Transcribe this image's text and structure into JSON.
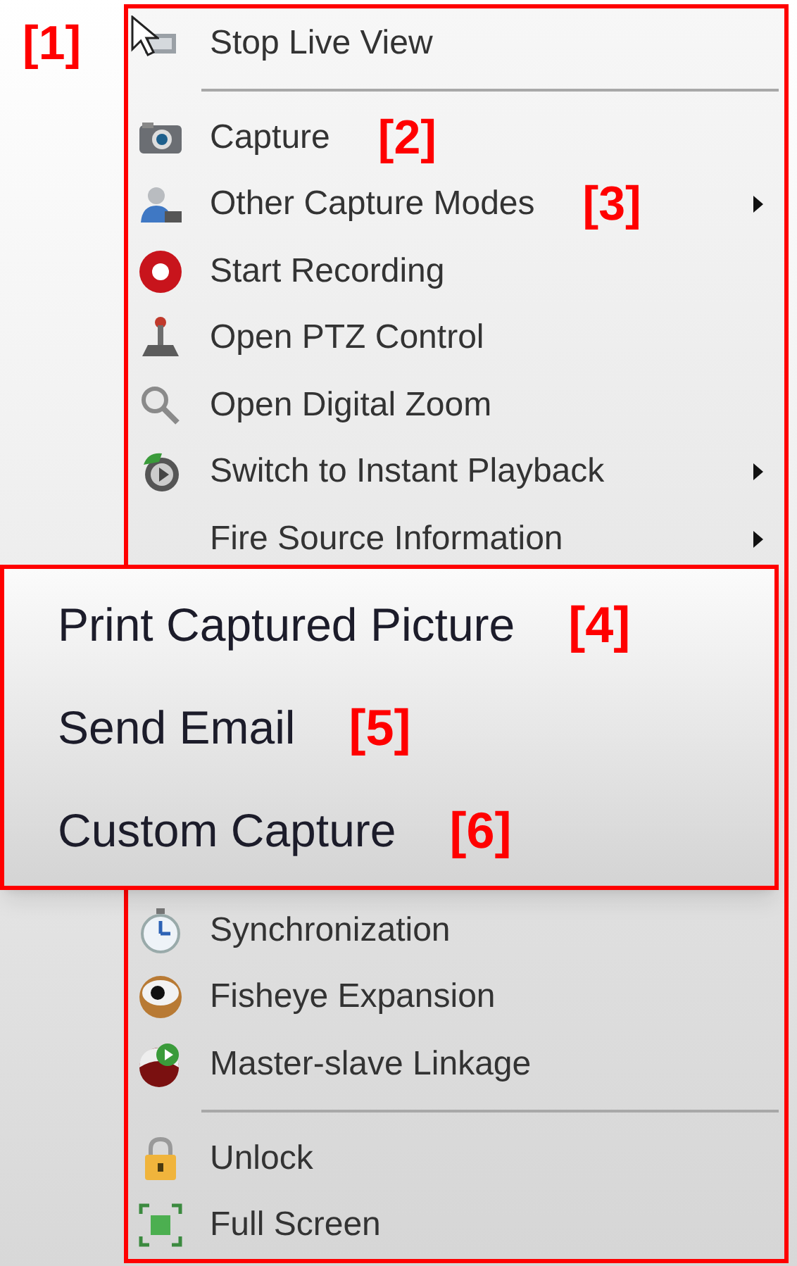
{
  "menu": {
    "annotation": "[1]",
    "items_above": [
      {
        "kind": "item",
        "label": "Stop Live View",
        "submenu": false
      },
      {
        "kind": "separator"
      },
      {
        "kind": "item",
        "label": "Capture",
        "submenu": false,
        "annotation": "[2]"
      },
      {
        "kind": "item",
        "label": "Other Capture Modes",
        "submenu": true,
        "annotation": "[3]"
      },
      {
        "kind": "item",
        "label": "Start Recording",
        "submenu": false
      },
      {
        "kind": "item",
        "label": "Open PTZ Control",
        "submenu": false
      },
      {
        "kind": "item",
        "label": "Open Digital Zoom",
        "submenu": false
      },
      {
        "kind": "item",
        "label": "Switch to Instant Playback",
        "submenu": true
      },
      {
        "kind": "item",
        "label": "Fire Source Information",
        "submenu": true
      }
    ],
    "items_below": [
      {
        "kind": "item",
        "label": "Synchronization",
        "submenu": false
      },
      {
        "kind": "item",
        "label": "Fisheye Expansion",
        "submenu": false
      },
      {
        "kind": "item",
        "label": "Master-slave Linkage",
        "submenu": false
      },
      {
        "kind": "separator"
      },
      {
        "kind": "item",
        "label": "Unlock",
        "submenu": false
      },
      {
        "kind": "item",
        "label": "Full Screen",
        "submenu": false
      }
    ]
  },
  "zoomed_panel": {
    "items": [
      {
        "label": "Print Captured Picture",
        "annotation": "[4]"
      },
      {
        "label": "Send Email",
        "annotation": "[5]"
      },
      {
        "label": "Custom Capture",
        "annotation": "[6]"
      }
    ]
  }
}
